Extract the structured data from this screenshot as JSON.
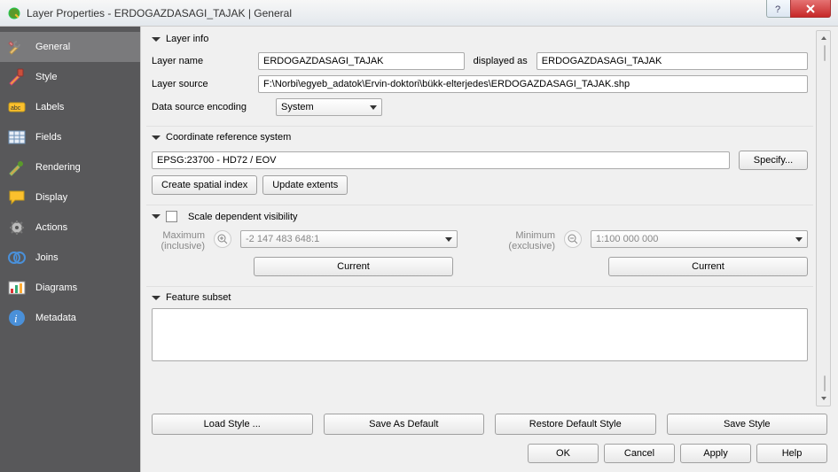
{
  "title": "Layer Properties - ERDOGAZDASAGI_TAJAK | General",
  "sidebar": {
    "items": [
      {
        "label": "General"
      },
      {
        "label": "Style"
      },
      {
        "label": "Labels"
      },
      {
        "label": "Fields"
      },
      {
        "label": "Rendering"
      },
      {
        "label": "Display"
      },
      {
        "label": "Actions"
      },
      {
        "label": "Joins"
      },
      {
        "label": "Diagrams"
      },
      {
        "label": "Metadata"
      }
    ]
  },
  "layer_info": {
    "heading": "Layer info",
    "name_label": "Layer name",
    "name_value": "ERDOGAZDASAGI_TAJAK",
    "displayed_as_label": "displayed as",
    "displayed_as_value": "ERDOGAZDASAGI_TAJAK",
    "source_label": "Layer source",
    "source_value": "F:\\Norbi\\egyeb_adatok\\Ervin-doktori\\bükk-elterjedes\\ERDOGAZDASAGI_TAJAK.shp",
    "encoding_label": "Data source encoding",
    "encoding_value": "System"
  },
  "crs": {
    "heading": "Coordinate reference system",
    "value": "EPSG:23700 - HD72 / EOV",
    "specify": "Specify...",
    "create_index": "Create spatial index",
    "update_extents": "Update extents"
  },
  "scale": {
    "heading": "Scale dependent visibility",
    "max_label_a": "Maximum",
    "max_label_b": "(inclusive)",
    "max_value": "-2 147 483 648:1",
    "min_label_a": "Minimum",
    "min_label_b": "(exclusive)",
    "min_value": "1:100 000 000",
    "current": "Current"
  },
  "subset": {
    "heading": "Feature subset",
    "value": ""
  },
  "buttons": {
    "load_style": "Load Style ...",
    "save_default": "Save As Default",
    "restore_default": "Restore Default Style",
    "save_style": "Save Style",
    "ok": "OK",
    "cancel": "Cancel",
    "apply": "Apply",
    "help": "Help"
  }
}
